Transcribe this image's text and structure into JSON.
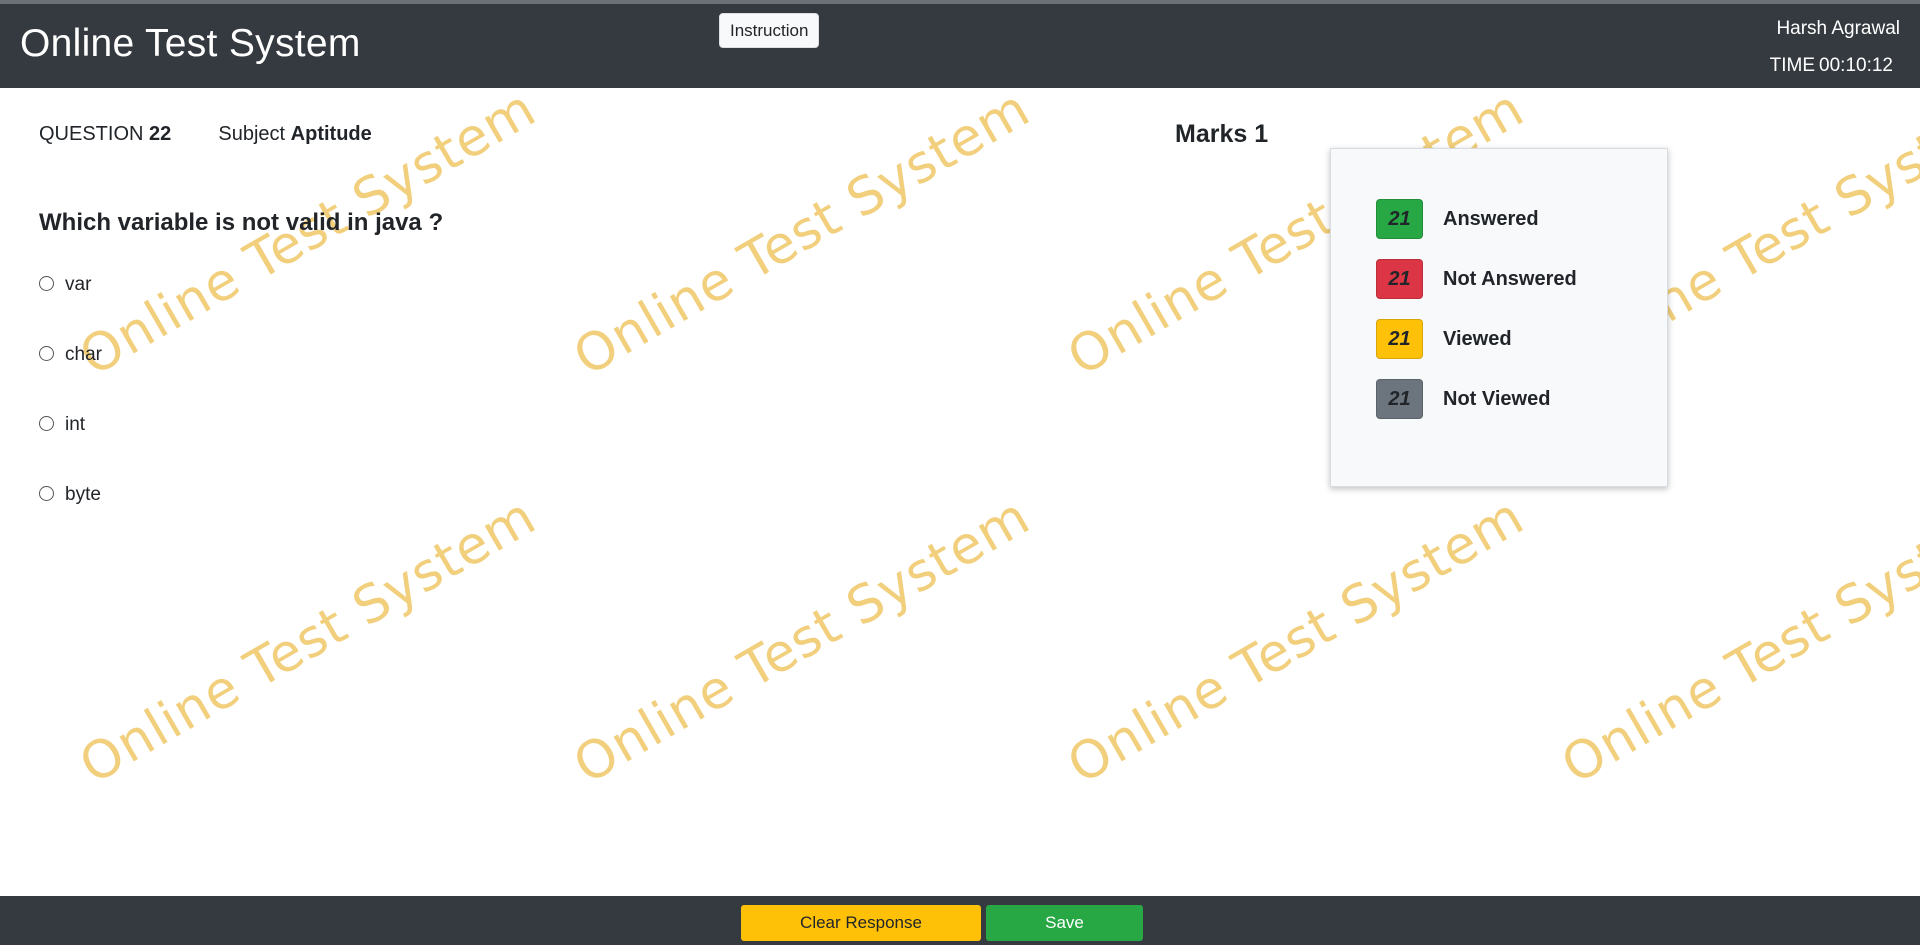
{
  "header": {
    "app_title": "Online Test System",
    "instruction_label": "Instruction",
    "user_name": "Harsh Agrawal",
    "timer_label": "TIME",
    "timer_value": "00:10:12"
  },
  "watermark_text": "Online Test System",
  "question": {
    "number_label": "QUESTION",
    "number": "22",
    "subject_label": "Subject",
    "subject": "Aptitude",
    "marks_label": "Marks",
    "marks": "1",
    "text": "Which variable is not valid in java ?",
    "options": [
      {
        "label": "var",
        "selected": false
      },
      {
        "label": "char",
        "selected": false
      },
      {
        "label": "int",
        "selected": false
      },
      {
        "label": "byte",
        "selected": false
      }
    ]
  },
  "legend": [
    {
      "count": "21",
      "label": "Answered",
      "color": "#28a745"
    },
    {
      "count": "21",
      "label": "Not Answered",
      "color": "#dc3545"
    },
    {
      "count": "21",
      "label": "Viewed",
      "color": "#ffc107"
    },
    {
      "count": "21",
      "label": "Not Viewed",
      "color": "#6c757d"
    }
  ],
  "footer": {
    "clear_label": "Clear Response",
    "save_label": "Save"
  }
}
